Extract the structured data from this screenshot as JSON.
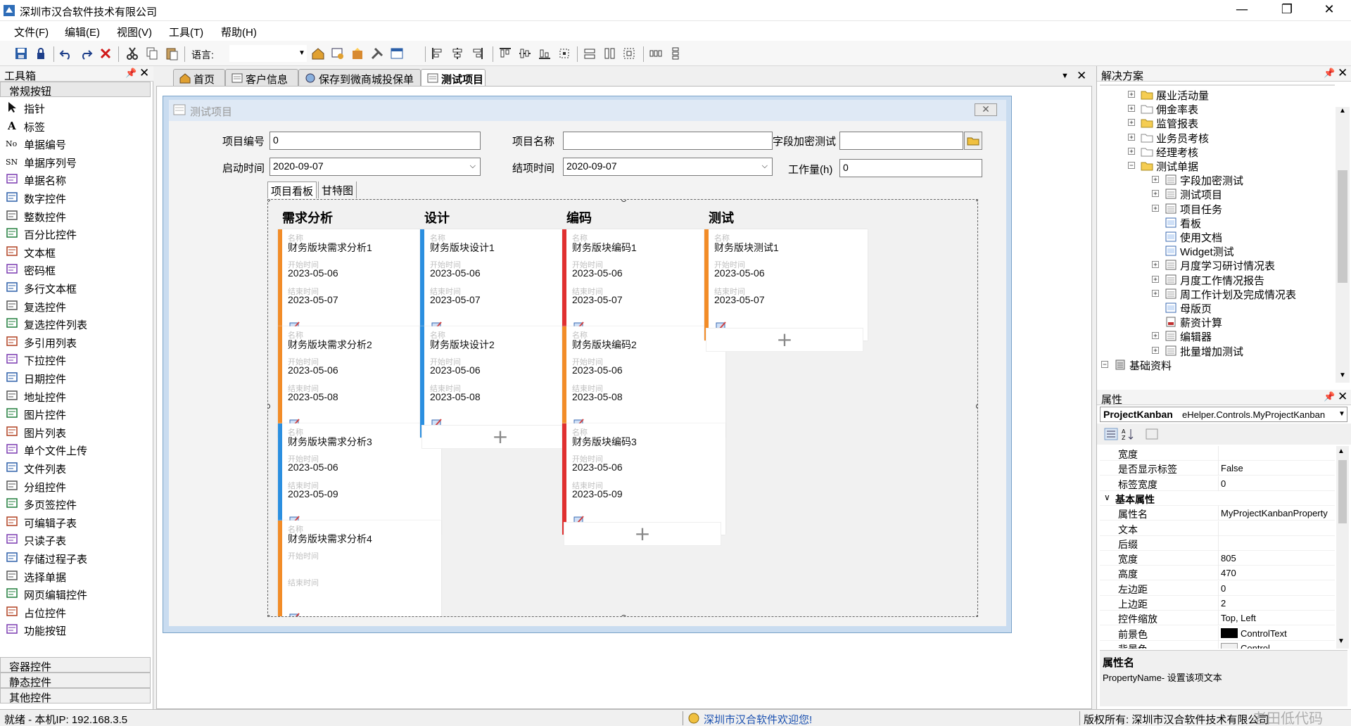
{
  "window": {
    "title": "深圳市汉合软件技术有限公司",
    "minimize": "—",
    "restore": "❐",
    "close": "✕"
  },
  "menu": [
    "文件(F)",
    "编辑(E)",
    "视图(V)",
    "工具(T)",
    "帮助(H)"
  ],
  "toolbar": {
    "language_label": "语言:",
    "language_value": ""
  },
  "toolbox": {
    "title": "工具箱",
    "group_general": "常规按钮",
    "items": [
      {
        "label": "指针",
        "icon": "pointer-icon"
      },
      {
        "label": "标签",
        "icon": "label-icon"
      },
      {
        "label": "单据编号",
        "icon": "doc-number-icon"
      },
      {
        "label": "单据序列号",
        "icon": "serial-number-icon"
      },
      {
        "label": "单据名称",
        "icon": "doc-name-icon"
      },
      {
        "label": "数字控件",
        "icon": "number-icon"
      },
      {
        "label": "整数控件",
        "icon": "integer-icon"
      },
      {
        "label": "百分比控件",
        "icon": "percent-icon"
      },
      {
        "label": "文本框",
        "icon": "textbox-icon"
      },
      {
        "label": "密码框",
        "icon": "password-icon"
      },
      {
        "label": "多行文本框",
        "icon": "multiline-icon"
      },
      {
        "label": "复选控件",
        "icon": "checkbox-icon"
      },
      {
        "label": "复选控件列表",
        "icon": "checklist-icon"
      },
      {
        "label": "多引用列表",
        "icon": "multiref-icon"
      },
      {
        "label": "下拉控件",
        "icon": "dropdown-icon"
      },
      {
        "label": "日期控件",
        "icon": "date-icon"
      },
      {
        "label": "地址控件",
        "icon": "address-icon"
      },
      {
        "label": "图片控件",
        "icon": "image-icon"
      },
      {
        "label": "图片列表",
        "icon": "image-list-icon"
      },
      {
        "label": "单个文件上传",
        "icon": "upload-icon"
      },
      {
        "label": "文件列表",
        "icon": "file-list-icon"
      },
      {
        "label": "分组控件",
        "icon": "group-icon"
      },
      {
        "label": "多页签控件",
        "icon": "tabs-icon"
      },
      {
        "label": "可编辑子表",
        "icon": "editable-table-icon"
      },
      {
        "label": "只读子表",
        "icon": "readonly-table-icon"
      },
      {
        "label": "存储过程子表",
        "icon": "procedure-table-icon"
      },
      {
        "label": "选择单据",
        "icon": "select-doc-icon"
      },
      {
        "label": "网页编辑控件",
        "icon": "web-editor-icon"
      },
      {
        "label": "占位控件",
        "icon": "placeholder-icon"
      },
      {
        "label": "功能按钮",
        "icon": "function-button-icon"
      }
    ],
    "bottom_groups": [
      "容器控件",
      "静态控件",
      "其他控件"
    ]
  },
  "doc_tabs": [
    "首页",
    "客户信息",
    "保存到微商城投保单",
    "测试项目"
  ],
  "form": {
    "title": "测试项目",
    "fields": {
      "code_label": "项目编号",
      "code_value": "0",
      "name_label": "项目名称",
      "name_value": "",
      "encrypt_label": "字段加密测试",
      "encrypt_value": "",
      "start_label": "启动时间",
      "start_value": "2020-09-07",
      "end_label": "结项时间",
      "end_value": "2020-09-07",
      "work_label": "工作量(h)",
      "work_value": "0"
    },
    "inner_tabs": [
      "项目看板",
      "甘特图"
    ]
  },
  "kanban": {
    "field_labels": {
      "name": "名称",
      "start": "开始时间",
      "end": "结束时间"
    },
    "add_symbol": "+",
    "columns": [
      {
        "title": "需求分析",
        "cards": [
          {
            "name": "财务版块需求分析1",
            "start": "2023-05-06",
            "end": "2023-05-07",
            "color": "#f28c28"
          },
          {
            "name": "财务版块需求分析2",
            "start": "2023-05-06",
            "end": "2023-05-08",
            "color": "#f28c28"
          },
          {
            "name": "财务版块需求分析3",
            "start": "2023-05-06",
            "end": "2023-05-09",
            "color": "#2b8fe0"
          },
          {
            "name": "财务版块需求分析4",
            "start": "",
            "end": "",
            "color": "#f28c28"
          }
        ],
        "add": false
      },
      {
        "title": "设计",
        "cards": [
          {
            "name": "财务版块设计1",
            "start": "2023-05-06",
            "end": "2023-05-07",
            "color": "#2b8fe0"
          },
          {
            "name": "财务版块设计2",
            "start": "2023-05-06",
            "end": "2023-05-08",
            "color": "#2b8fe0"
          }
        ],
        "add": true
      },
      {
        "title": "编码",
        "cards": [
          {
            "name": "财务版块编码1",
            "start": "2023-05-06",
            "end": "2023-05-07",
            "color": "#e03030"
          },
          {
            "name": "财务版块编码2",
            "start": "2023-05-06",
            "end": "2023-05-08",
            "color": "#f28c28"
          },
          {
            "name": "财务版块编码3",
            "start": "2023-05-06",
            "end": "2023-05-09",
            "color": "#e03030"
          }
        ],
        "add": true
      },
      {
        "title": "测试",
        "cards": [
          {
            "name": "财务版块测试1",
            "start": "2023-05-06",
            "end": "2023-05-07",
            "color": "#f28c28"
          }
        ],
        "add": true
      }
    ]
  },
  "solution": {
    "title": "解决方案",
    "nodes": [
      {
        "label": "展业活动量",
        "level": 1,
        "type": "folder",
        "exp": "+"
      },
      {
        "label": "佣金率表",
        "level": 1,
        "type": "folder-empty",
        "exp": "+"
      },
      {
        "label": "监管报表",
        "level": 1,
        "type": "folder",
        "exp": "+"
      },
      {
        "label": "业务员考核",
        "level": 1,
        "type": "folder-empty",
        "exp": "+"
      },
      {
        "label": "经理考核",
        "level": 1,
        "type": "folder-empty",
        "exp": "+"
      },
      {
        "label": "测试单据",
        "level": 1,
        "type": "folder",
        "exp": "-"
      },
      {
        "label": "字段加密测试",
        "level": 2,
        "type": "form",
        "exp": "+"
      },
      {
        "label": "测试项目",
        "level": 2,
        "type": "form",
        "exp": "+"
      },
      {
        "label": "项目任务",
        "level": 2,
        "type": "form",
        "exp": "+"
      },
      {
        "label": "看板",
        "level": 2,
        "type": "page",
        "exp": ""
      },
      {
        "label": "使用文档",
        "level": 2,
        "type": "page",
        "exp": ""
      },
      {
        "label": "Widget测试",
        "level": 2,
        "type": "page",
        "exp": ""
      },
      {
        "label": "月度学习研讨情况表",
        "level": 2,
        "type": "form",
        "exp": "+"
      },
      {
        "label": "月度工作情况报告",
        "level": 2,
        "type": "form",
        "exp": "+"
      },
      {
        "label": "周工作计划及完成情况表",
        "level": 2,
        "type": "form",
        "exp": "+"
      },
      {
        "label": "母版页",
        "level": 2,
        "type": "page",
        "exp": ""
      },
      {
        "label": "薪资计算",
        "level": 2,
        "type": "report",
        "exp": ""
      },
      {
        "label": "编辑器",
        "level": 2,
        "type": "form",
        "exp": "+"
      },
      {
        "label": "批量增加测试",
        "level": 2,
        "type": "form",
        "exp": "+"
      },
      {
        "label": "基础资料",
        "level": 0,
        "type": "db",
        "exp": "-"
      }
    ]
  },
  "properties": {
    "title": "属性",
    "object_name": "ProjectKanban",
    "object_type": "eHelper.Controls.MyProjectKanban",
    "rows": [
      {
        "name": "宽度",
        "value": "",
        "category": false
      },
      {
        "name": "是否显示标签",
        "value": "False",
        "category": false
      },
      {
        "name": "标签宽度",
        "value": "0",
        "category": false
      },
      {
        "name": "基本属性",
        "value": "",
        "category": true
      },
      {
        "name": "属性名",
        "value": "MyProjectKanbanProperty",
        "category": false
      },
      {
        "name": "文本",
        "value": "",
        "category": false
      },
      {
        "name": "后缀",
        "value": "",
        "category": false
      },
      {
        "name": "宽度",
        "value": "805",
        "category": false
      },
      {
        "name": "高度",
        "value": "470",
        "category": false
      },
      {
        "name": "左边距",
        "value": "0",
        "category": false
      },
      {
        "name": "上边距",
        "value": "2",
        "category": false
      },
      {
        "name": "控件缩放",
        "value": "Top, Left",
        "category": false
      },
      {
        "name": "前景色",
        "value": "ControlText",
        "category": false
      },
      {
        "name": "背景色",
        "value": "Control",
        "category": false
      }
    ],
    "desc_title": "属性名",
    "desc_text": "PropertyName- 设置该项文本"
  },
  "status": {
    "left": "就绪 - 本机IP: 192.168.3.5",
    "center": "深圳市汉合软件欢迎您!",
    "right": "版权所有: 深圳市汉合软件技术有限公司",
    "watermark": "老田低代码"
  }
}
